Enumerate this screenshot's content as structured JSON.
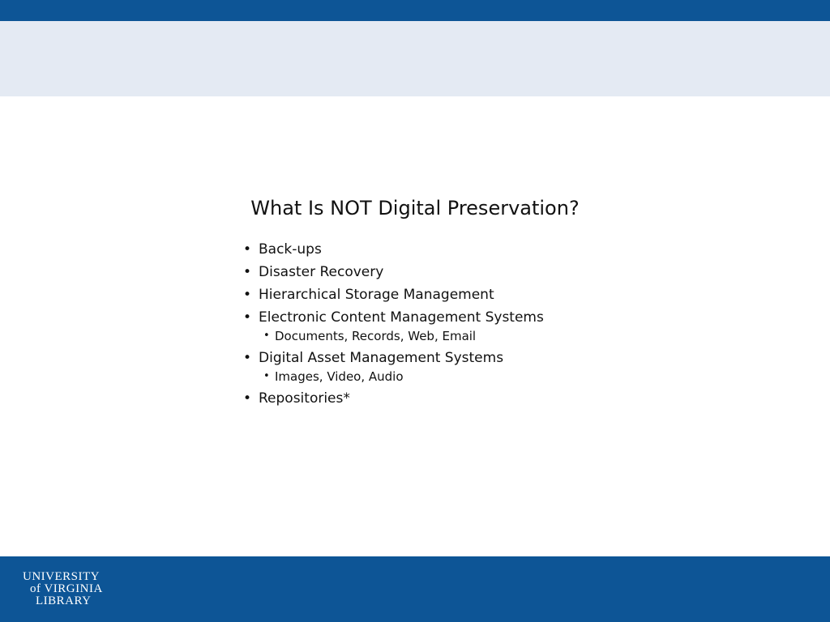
{
  "colors": {
    "top_band": "#0d5596",
    "header_band": "#e4eaf3",
    "footer_band": "#0d5596",
    "background": "#ffffff",
    "text": "#111111"
  },
  "slide": {
    "title": "What Is NOT Digital Preservation?",
    "bullets": [
      {
        "text": "Back-ups"
      },
      {
        "text": "Disaster Recovery"
      },
      {
        "text": "Hierarchical Storage Management"
      },
      {
        "text": "Electronic Content Management Systems",
        "sub": [
          "Documents, Records, Web, Email"
        ]
      },
      {
        "text": "Digital Asset Management Systems",
        "sub": [
          "Images, Video, Audio"
        ]
      },
      {
        "text": "Repositories*"
      }
    ]
  },
  "footer": {
    "logo_lines": [
      "UNIVERSITY",
      "of VIRGINIA",
      "LIBRARY"
    ]
  }
}
